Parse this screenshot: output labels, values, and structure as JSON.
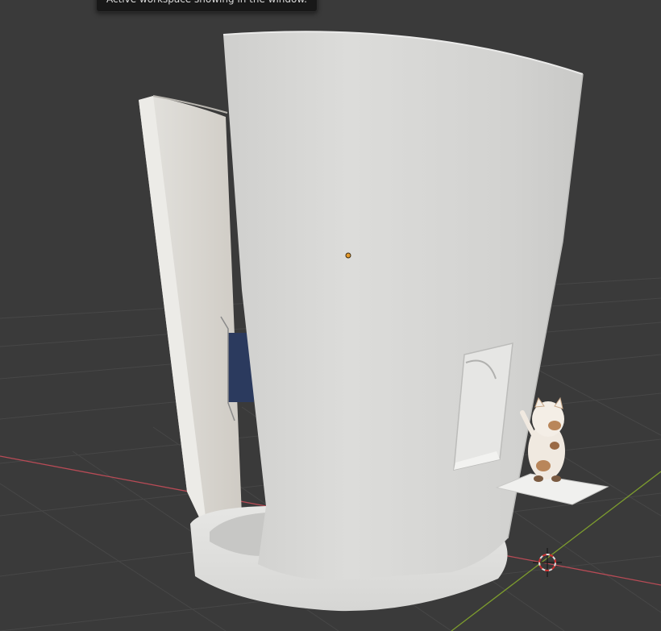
{
  "tooltip": {
    "text": "Active workspace showing in the window."
  },
  "viewport": {
    "background": "#3a3a3a",
    "grid_color": "#4a4a4a",
    "x_axis_color": "#b84b56",
    "y_axis_color": "#7d9c2e",
    "model_color": "#d6d6d4",
    "origin_color": "#e59a2b"
  }
}
